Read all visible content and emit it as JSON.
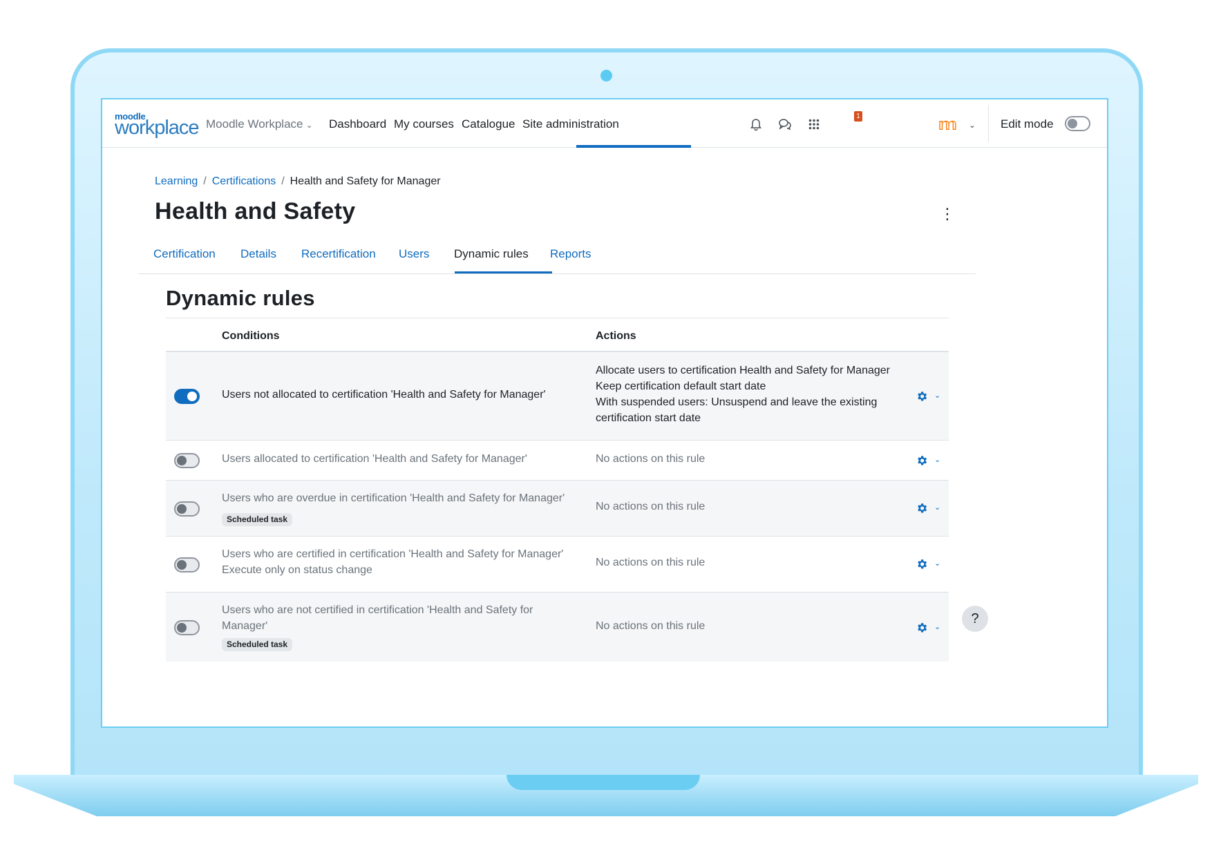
{
  "app": {
    "logo_small": "moodle",
    "logo_big": "workplace"
  },
  "navbar": {
    "site_menu": "Moodle Workplace",
    "links": [
      "Dashboard",
      "My courses",
      "Catalogue",
      "Site administration"
    ],
    "active_link": "Site administration",
    "notification_count": "1",
    "edit_mode_label": "Edit mode",
    "edit_mode_on": false
  },
  "breadcrumb": [
    "Learning",
    "Certifications",
    "Health and Safety for Manager"
  ],
  "page_title": "Health and Safety",
  "tabs": [
    "Certification",
    "Details",
    "Recertification",
    "Users",
    "Dynamic rules",
    "Reports"
  ],
  "active_tab": "Dynamic rules",
  "section_title": "Dynamic rules",
  "table": {
    "headers": {
      "conditions": "Conditions",
      "actions": "Actions"
    },
    "rows": [
      {
        "enabled": true,
        "conditions": [
          "Users not allocated to certification 'Health and Safety for Manager'"
        ],
        "badge": "",
        "actions": [
          "Allocate users to certification Health and Safety for Manager",
          "Keep certification default start date",
          "With suspended users: Unsuspend and leave the existing certification start date"
        ]
      },
      {
        "enabled": false,
        "conditions": [
          "Users allocated to certification 'Health and Safety for Manager'"
        ],
        "badge": "",
        "actions": [
          "No actions on this rule"
        ]
      },
      {
        "enabled": false,
        "conditions": [
          "Users who are overdue in certification 'Health and Safety for Manager'"
        ],
        "badge": "Scheduled task",
        "actions": [
          "No actions on this rule"
        ]
      },
      {
        "enabled": false,
        "conditions": [
          "Users who are certified in certification 'Health and Safety for Manager'",
          "Execute only on status change"
        ],
        "badge": "",
        "actions": [
          "No actions on this rule"
        ]
      },
      {
        "enabled": false,
        "conditions": [
          "Users who are not certified in certification 'Health and Safety for Manager'"
        ],
        "badge": "Scheduled task",
        "actions": [
          "No actions on this rule"
        ]
      }
    ]
  },
  "help_button": "?",
  "colors": {
    "primary": "#0f6cbf",
    "text": "#1d2125",
    "muted": "#6a737b",
    "notification": "#d4501f",
    "frame": "#bfe9fb"
  }
}
